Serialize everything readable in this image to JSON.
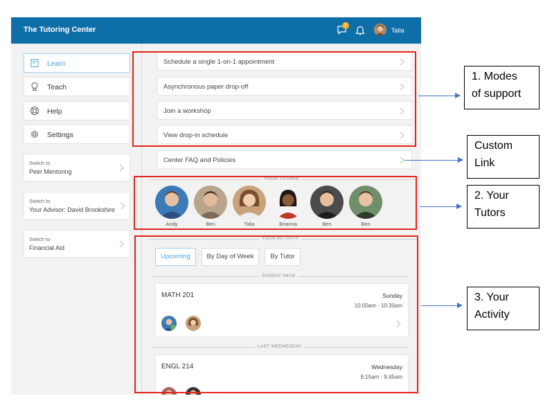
{
  "app": {
    "title": "The Tutoring Center",
    "chat_badge": "3",
    "user_name": "Talia"
  },
  "sidebar": {
    "items": [
      {
        "label": "Learn",
        "icon": "book-icon"
      },
      {
        "label": "Teach",
        "icon": "lightbulb-icon"
      },
      {
        "label": "Help",
        "icon": "lifebuoy-icon"
      },
      {
        "label": "Settings",
        "icon": "gear-icon"
      }
    ],
    "switches": [
      {
        "small": "Switch to",
        "target": "Peer Mentoring"
      },
      {
        "small": "Switch to",
        "target": "Your Advisor: David Brookshire"
      },
      {
        "small": "Switch to",
        "target": "Financial Aid"
      }
    ]
  },
  "support_modes": [
    "Schedule a single 1-on-1 appointment",
    "Asynchronous paper drop-off",
    "Join a workshop",
    "View drop-in schedule"
  ],
  "custom_link": "Center FAQ and Policies",
  "tutors": {
    "label": "YOUR TUTORS",
    "people": [
      "Andy",
      "Ben",
      "Talia",
      "Brianna",
      "Ben",
      "Ben"
    ]
  },
  "activity": {
    "label": "YOUR ACTIVITY",
    "filters": [
      "Upcoming",
      "By Day of Week",
      "By Tutor"
    ],
    "groups": [
      {
        "label": "SUNDAY 04/24",
        "course": "MATH 201",
        "day": "Sunday",
        "time": "10:00am - 10:30am"
      },
      {
        "label": "LAST WEDNESDAY",
        "course": "ENGL 214",
        "day": "Wednesday",
        "time": "9:15am - 9:45am"
      }
    ]
  },
  "callouts": {
    "modes": [
      "1. Modes",
      "of support"
    ],
    "custom": [
      "Custom",
      "Link"
    ],
    "tutors": [
      "2. Your",
      "Tutors"
    ],
    "activity": [
      "3. Your",
      "Activity"
    ]
  },
  "colors": {
    "topbar": "#0e6fa8",
    "accent": "#4aa6d9",
    "annotation_red": "#e2231a",
    "arrow_blue": "#4472c4",
    "badge": "#f0ad1f"
  }
}
